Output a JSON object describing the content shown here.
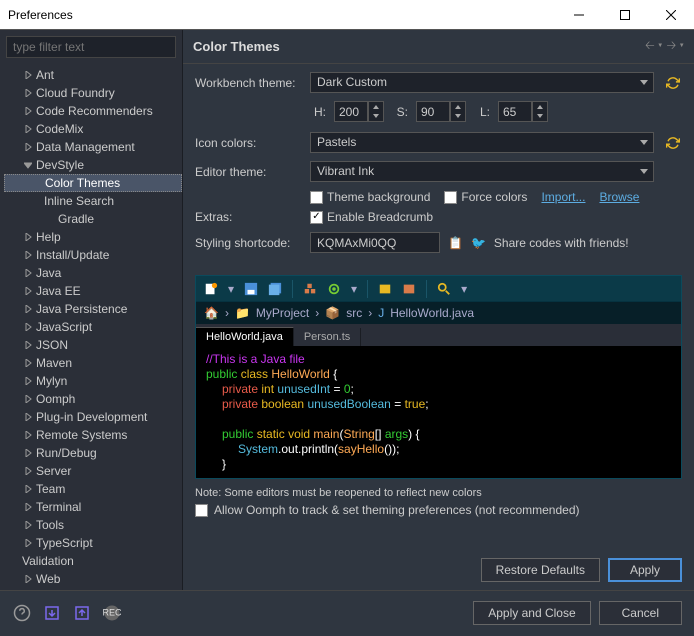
{
  "window": {
    "title": "Preferences"
  },
  "filter": {
    "placeholder": "type filter text"
  },
  "tree": [
    {
      "label": "Ant",
      "exp": false,
      "level": 1
    },
    {
      "label": "Cloud Foundry",
      "exp": false,
      "level": 1
    },
    {
      "label": "Code Recommenders",
      "exp": false,
      "level": 1
    },
    {
      "label": "CodeMix",
      "exp": false,
      "level": 1
    },
    {
      "label": "Data Management",
      "exp": false,
      "level": 1
    },
    {
      "label": "DevStyle",
      "exp": true,
      "level": 1
    },
    {
      "label": "Color Themes",
      "level": 2,
      "selected": true
    },
    {
      "label": "Inline Search",
      "level": 2
    },
    {
      "label": "Gradle",
      "level": 2,
      "leaf": true
    },
    {
      "label": "Help",
      "exp": false,
      "level": 1
    },
    {
      "label": "Install/Update",
      "exp": false,
      "level": 1
    },
    {
      "label": "Java",
      "exp": false,
      "level": 1
    },
    {
      "label": "Java EE",
      "exp": false,
      "level": 1
    },
    {
      "label": "Java Persistence",
      "exp": false,
      "level": 1
    },
    {
      "label": "JavaScript",
      "exp": false,
      "level": 1
    },
    {
      "label": "JSON",
      "exp": false,
      "level": 1
    },
    {
      "label": "Maven",
      "exp": false,
      "level": 1
    },
    {
      "label": "Mylyn",
      "exp": false,
      "level": 1
    },
    {
      "label": "Oomph",
      "exp": false,
      "level": 1
    },
    {
      "label": "Plug-in Development",
      "exp": false,
      "level": 1
    },
    {
      "label": "Remote Systems",
      "exp": false,
      "level": 1
    },
    {
      "label": "Run/Debug",
      "exp": false,
      "level": 1
    },
    {
      "label": "Server",
      "exp": false,
      "level": 1
    },
    {
      "label": "Team",
      "exp": false,
      "level": 1
    },
    {
      "label": "Terminal",
      "exp": false,
      "level": 1
    },
    {
      "label": "Tools",
      "exp": false,
      "level": 1
    },
    {
      "label": "TypeScript",
      "exp": false,
      "level": 1
    },
    {
      "label": "Validation",
      "level": 1,
      "leaf": true
    },
    {
      "label": "Web",
      "exp": false,
      "level": 1
    }
  ],
  "heading": "Color Themes",
  "form": {
    "workbench_label": "Workbench theme:",
    "workbench_value": "Dark Custom",
    "h_label": "H:",
    "h_value": "200",
    "s_label": "S:",
    "s_value": "90",
    "l_label": "L:",
    "l_value": "65",
    "icon_label": "Icon colors:",
    "icon_value": "Pastels",
    "editor_label": "Editor theme:",
    "editor_value": "Vibrant Ink",
    "theme_bg": "Theme background",
    "force_colors": "Force colors",
    "import": "Import...",
    "browse": "Browse",
    "extras_label": "Extras:",
    "breadcrumb": "Enable Breadcrumb",
    "shortcode_label": "Styling shortcode:",
    "shortcode_value": "KQMAxMi0QQ",
    "share_text": "Share codes with friends!"
  },
  "preview": {
    "bread_project": "MyProject",
    "bread_src": "src",
    "bread_file": "HelloWorld.java",
    "tab1": "HelloWorld.java",
    "tab2": "Person.ts",
    "code": {
      "l1": "//This is a Java file",
      "l2a": "public",
      "l2b": "class",
      "l2c": "HelloWorld",
      "l2d": "{",
      "l3a": "private",
      "l3b": "int",
      "l3c": "unusedInt",
      "l3d": "=",
      "l3e": "0",
      "l3f": ";",
      "l4a": "private",
      "l4b": "boolean",
      "l4c": "unusedBoolean",
      "l4d": "=",
      "l4e": "true",
      "l4f": ";",
      "l5a": "public",
      "l5b": "static",
      "l5c": "void",
      "l5d": "main",
      "l5e": "(",
      "l5f": "String",
      "l5g": "[]",
      "l5h": "args",
      "l5i": ") {",
      "l6a": "System",
      "l6b": ".out.println(",
      "l6c": "sayHello",
      "l6d": "());",
      "l7": "}"
    }
  },
  "note": "Note: Some editors must be reopened to reflect new colors",
  "oomph": "Allow Oomph to track & set theming preferences (not recommended)",
  "buttons": {
    "restore": "Restore Defaults",
    "apply": "Apply",
    "apply_close": "Apply and Close",
    "cancel": "Cancel"
  }
}
